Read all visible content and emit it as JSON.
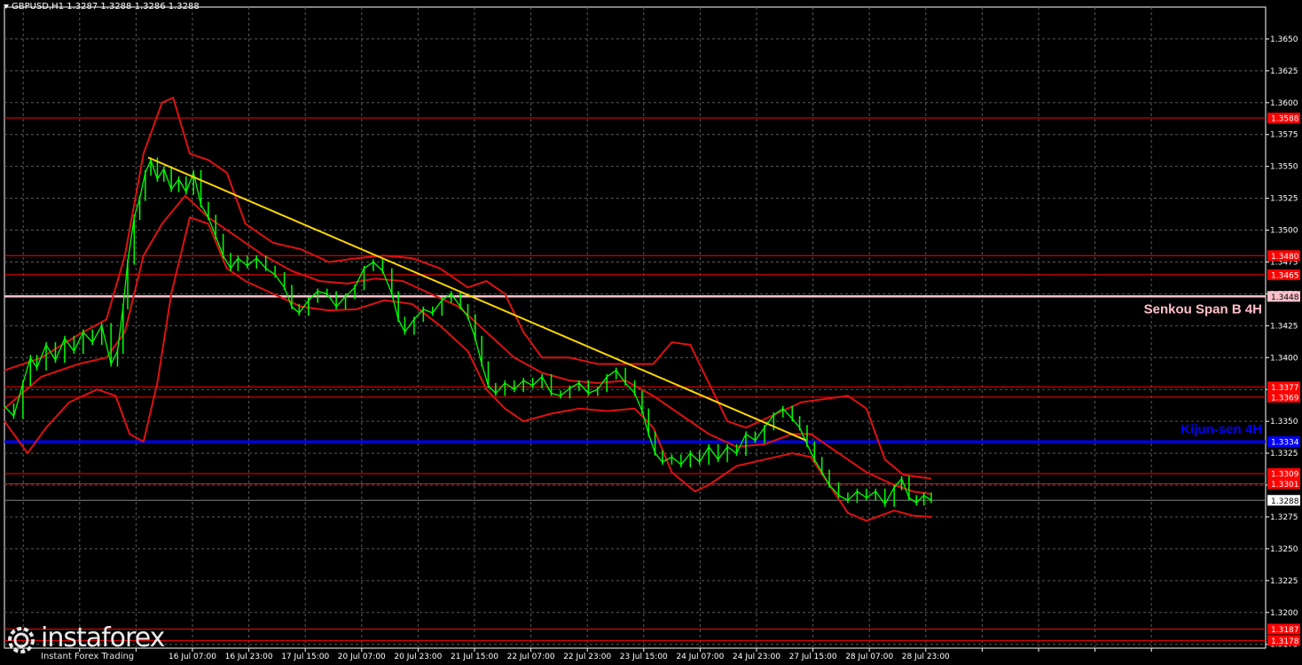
{
  "header": {
    "text": "GBPUSD,H1  1.3287 1.3288 1.3286 1.3288"
  },
  "logo": {
    "name": "instaforex",
    "tagline": "Instant Forex Trading"
  },
  "colors": {
    "background": "#000000",
    "grid": "#5a5a5a",
    "price": "#00ff00",
    "bands": "#dd1111",
    "levels": "#ff0000",
    "trend": "#ffd700",
    "kijun": "#0000ff",
    "senkou": "#ffc0cb",
    "axis": "#ffffff",
    "current": "#7f7f7f"
  },
  "chart_data": {
    "type": "line",
    "symbol": "GBPUSD",
    "timeframe": "H1",
    "ylim": [
      1.3172,
      1.3675
    ],
    "y_ticks": [
      "1.3175",
      "1.3200",
      "1.3225",
      "1.3250",
      "1.3275",
      "1.3300",
      "1.3325",
      "1.3350",
      "1.3375",
      "1.3400",
      "1.3425",
      "1.3450",
      "1.3475",
      "1.3500",
      "1.3525",
      "1.3550",
      "1.3575",
      "1.3600",
      "1.3625",
      "1.3650"
    ],
    "x_ticks": [
      "16 Jul 07:00",
      "16 Jul 23:00",
      "17 Jul 15:00",
      "20 Jul 07:00",
      "20 Jul 23:00",
      "21 Jul 15:00",
      "22 Jul 07:00",
      "22 Jul 23:00",
      "23 Jul 15:00",
      "24 Jul 07:00",
      "24 Jul 23:00",
      "27 Jul 15:00",
      "28 Jul 07:00",
      "28 Jul 23:00"
    ],
    "levels": [
      {
        "label": "1.3588",
        "value": 1.3588
      },
      {
        "label": "1.3480",
        "value": 1.348
      },
      {
        "label": "1.3465",
        "value": 1.3465
      },
      {
        "label": "1.3377",
        "value": 1.3377
      },
      {
        "label": "1.3369",
        "value": 1.3369
      },
      {
        "label": "1.3309",
        "value": 1.3309
      },
      {
        "label": "1.3301",
        "value": 1.3301
      },
      {
        "label": "1.3187",
        "value": 1.3187
      },
      {
        "label": "1.3178",
        "value": 1.3178
      }
    ],
    "senkou_span_b": {
      "label": "Senkou Span B 4H",
      "value": 1.3448,
      "tag": "1.3448"
    },
    "kijun_sen": {
      "label": "Kijun-sen 4H",
      "value": 1.3334,
      "tag": "1.3334"
    },
    "current_price": {
      "label": "1.3288",
      "value": 1.3288
    },
    "trendline": {
      "from": [
        0.155,
        1.3557
      ],
      "to": [
        0.865,
        1.3335
      ]
    },
    "price_series": [
      [
        0.0,
        1.3362
      ],
      [
        0.01,
        1.3354
      ],
      [
        0.02,
        1.338
      ],
      [
        0.028,
        1.34
      ],
      [
        0.035,
        1.3392
      ],
      [
        0.045,
        1.341
      ],
      [
        0.055,
        1.3398
      ],
      [
        0.065,
        1.3415
      ],
      [
        0.075,
        1.3405
      ],
      [
        0.085,
        1.342
      ],
      [
        0.095,
        1.3412
      ],
      [
        0.105,
        1.3425
      ],
      [
        0.115,
        1.3395
      ],
      [
        0.122,
        1.3405
      ],
      [
        0.128,
        1.344
      ],
      [
        0.133,
        1.3475
      ],
      [
        0.14,
        1.351
      ],
      [
        0.146,
        1.3525
      ],
      [
        0.152,
        1.3545
      ],
      [
        0.158,
        1.3555
      ],
      [
        0.165,
        1.354
      ],
      [
        0.172,
        1.3548
      ],
      [
        0.18,
        1.3532
      ],
      [
        0.188,
        1.354
      ],
      [
        0.196,
        1.353
      ],
      [
        0.204,
        1.3545
      ],
      [
        0.212,
        1.352
      ],
      [
        0.22,
        1.351
      ],
      [
        0.228,
        1.3495
      ],
      [
        0.236,
        1.348
      ],
      [
        0.244,
        1.347
      ],
      [
        0.252,
        1.3478
      ],
      [
        0.262,
        1.3472
      ],
      [
        0.272,
        1.3478
      ],
      [
        0.282,
        1.347
      ],
      [
        0.292,
        1.3465
      ],
      [
        0.302,
        1.3455
      ],
      [
        0.31,
        1.344
      ],
      [
        0.318,
        1.3435
      ],
      [
        0.328,
        1.3445
      ],
      [
        0.338,
        1.3452
      ],
      [
        0.348,
        1.345
      ],
      [
        0.358,
        1.344
      ],
      [
        0.368,
        1.3448
      ],
      [
        0.378,
        1.3455
      ],
      [
        0.388,
        1.347
      ],
      [
        0.398,
        1.3475
      ],
      [
        0.408,
        1.3468
      ],
      [
        0.418,
        1.345
      ],
      [
        0.425,
        1.343
      ],
      [
        0.432,
        1.342
      ],
      [
        0.442,
        1.343
      ],
      [
        0.452,
        1.3438
      ],
      [
        0.462,
        1.3435
      ],
      [
        0.472,
        1.3445
      ],
      [
        0.482,
        1.345
      ],
      [
        0.492,
        1.344
      ],
      [
        0.5,
        1.3432
      ],
      [
        0.508,
        1.3415
      ],
      [
        0.515,
        1.3395
      ],
      [
        0.522,
        1.3378
      ],
      [
        0.53,
        1.3372
      ],
      [
        0.54,
        1.338
      ],
      [
        0.55,
        1.3375
      ],
      [
        0.56,
        1.3382
      ],
      [
        0.57,
        1.3378
      ],
      [
        0.58,
        1.3385
      ],
      [
        0.59,
        1.3372
      ],
      [
        0.6,
        1.337
      ],
      [
        0.61,
        1.3376
      ],
      [
        0.62,
        1.338
      ],
      [
        0.63,
        1.3372
      ],
      [
        0.64,
        1.3375
      ],
      [
        0.65,
        1.3385
      ],
      [
        0.66,
        1.339
      ],
      [
        0.67,
        1.338
      ],
      [
        0.68,
        1.3372
      ],
      [
        0.688,
        1.3358
      ],
      [
        0.695,
        1.334
      ],
      [
        0.702,
        1.3325
      ],
      [
        0.71,
        1.3318
      ],
      [
        0.72,
        1.3322
      ],
      [
        0.73,
        1.3316
      ],
      [
        0.74,
        1.3325
      ],
      [
        0.75,
        1.3318
      ],
      [
        0.76,
        1.333
      ],
      [
        0.77,
        1.332
      ],
      [
        0.78,
        1.333
      ],
      [
        0.79,
        1.3325
      ],
      [
        0.8,
        1.334
      ],
      [
        0.81,
        1.3335
      ],
      [
        0.82,
        1.3345
      ],
      [
        0.83,
        1.3355
      ],
      [
        0.84,
        1.336
      ],
      [
        0.85,
        1.3352
      ],
      [
        0.858,
        1.3345
      ],
      [
        0.866,
        1.3332
      ],
      [
        0.874,
        1.332
      ],
      [
        0.882,
        1.331
      ],
      [
        0.89,
        1.33
      ],
      [
        0.9,
        1.3292
      ],
      [
        0.91,
        1.3288
      ],
      [
        0.92,
        1.3295
      ],
      [
        0.93,
        1.329
      ],
      [
        0.94,
        1.3295
      ],
      [
        0.95,
        1.3285
      ],
      [
        0.96,
        1.3298
      ],
      [
        0.968,
        1.3305
      ],
      [
        0.976,
        1.329
      ],
      [
        0.984,
        1.3286
      ],
      [
        0.992,
        1.3292
      ],
      [
        1.0,
        1.3288
      ]
    ],
    "band_upper": [
      [
        0.0,
        1.339
      ],
      [
        0.04,
        1.34
      ],
      [
        0.08,
        1.3418
      ],
      [
        0.11,
        1.343
      ],
      [
        0.13,
        1.348
      ],
      [
        0.15,
        1.356
      ],
      [
        0.17,
        1.36
      ],
      [
        0.182,
        1.3604
      ],
      [
        0.2,
        1.356
      ],
      [
        0.22,
        1.3555
      ],
      [
        0.24,
        1.3545
      ],
      [
        0.26,
        1.3505
      ],
      [
        0.29,
        1.349
      ],
      [
        0.32,
        1.3485
      ],
      [
        0.35,
        1.3475
      ],
      [
        0.38,
        1.3478
      ],
      [
        0.41,
        1.348
      ],
      [
        0.44,
        1.3478
      ],
      [
        0.47,
        1.347
      ],
      [
        0.5,
        1.3455
      ],
      [
        0.52,
        1.346
      ],
      [
        0.54,
        1.345
      ],
      [
        0.56,
        1.342
      ],
      [
        0.58,
        1.34
      ],
      [
        0.61,
        1.34
      ],
      [
        0.64,
        1.3395
      ],
      [
        0.67,
        1.3395
      ],
      [
        0.7,
        1.3395
      ],
      [
        0.72,
        1.3412
      ],
      [
        0.74,
        1.341
      ],
      [
        0.76,
        1.338
      ],
      [
        0.78,
        1.335
      ],
      [
        0.8,
        1.3345
      ],
      [
        0.83,
        1.3355
      ],
      [
        0.86,
        1.3365
      ],
      [
        0.89,
        1.3368
      ],
      [
        0.91,
        1.337
      ],
      [
        0.93,
        1.336
      ],
      [
        0.95,
        1.332
      ],
      [
        0.97,
        1.3308
      ],
      [
        0.99,
        1.3306
      ],
      [
        1.0,
        1.3305
      ]
    ],
    "band_middle": [
      [
        0.0,
        1.336
      ],
      [
        0.04,
        1.3385
      ],
      [
        0.08,
        1.3395
      ],
      [
        0.11,
        1.34
      ],
      [
        0.13,
        1.342
      ],
      [
        0.15,
        1.348
      ],
      [
        0.17,
        1.3505
      ],
      [
        0.195,
        1.3527
      ],
      [
        0.22,
        1.351
      ],
      [
        0.25,
        1.3495
      ],
      [
        0.28,
        1.348
      ],
      [
        0.31,
        1.3468
      ],
      [
        0.34,
        1.346
      ],
      [
        0.37,
        1.3458
      ],
      [
        0.4,
        1.3462
      ],
      [
        0.43,
        1.346
      ],
      [
        0.46,
        1.345
      ],
      [
        0.49,
        1.344
      ],
      [
        0.52,
        1.342
      ],
      [
        0.55,
        1.34
      ],
      [
        0.58,
        1.3388
      ],
      [
        0.61,
        1.3382
      ],
      [
        0.64,
        1.338
      ],
      [
        0.67,
        1.3382
      ],
      [
        0.7,
        1.337
      ],
      [
        0.73,
        1.3355
      ],
      [
        0.76,
        1.334
      ],
      [
        0.79,
        1.333
      ],
      [
        0.82,
        1.3332
      ],
      [
        0.85,
        1.334
      ],
      [
        0.87,
        1.334
      ],
      [
        0.9,
        1.3325
      ],
      [
        0.93,
        1.331
      ],
      [
        0.96,
        1.33
      ],
      [
        0.98,
        1.3295
      ],
      [
        1.0,
        1.3293
      ]
    ],
    "band_lower": [
      [
        0.0,
        1.335
      ],
      [
        0.025,
        1.3325
      ],
      [
        0.045,
        1.3345
      ],
      [
        0.07,
        1.3365
      ],
      [
        0.1,
        1.3375
      ],
      [
        0.12,
        1.337
      ],
      [
        0.135,
        1.334
      ],
      [
        0.15,
        1.3334
      ],
      [
        0.165,
        1.338
      ],
      [
        0.18,
        1.345
      ],
      [
        0.2,
        1.351
      ],
      [
        0.22,
        1.3505
      ],
      [
        0.24,
        1.347
      ],
      [
        0.26,
        1.346
      ],
      [
        0.29,
        1.345
      ],
      [
        0.32,
        1.344
      ],
      [
        0.35,
        1.3437
      ],
      [
        0.38,
        1.3438
      ],
      [
        0.41,
        1.3445
      ],
      [
        0.44,
        1.3442
      ],
      [
        0.47,
        1.3425
      ],
      [
        0.5,
        1.3405
      ],
      [
        0.52,
        1.3375
      ],
      [
        0.54,
        1.336
      ],
      [
        0.56,
        1.335
      ],
      [
        0.59,
        1.3356
      ],
      [
        0.62,
        1.336
      ],
      [
        0.65,
        1.3358
      ],
      [
        0.68,
        1.336
      ],
      [
        0.7,
        1.3345
      ],
      [
        0.72,
        1.331
      ],
      [
        0.745,
        1.3295
      ],
      [
        0.76,
        1.33
      ],
      [
        0.79,
        1.3315
      ],
      [
        0.82,
        1.332
      ],
      [
        0.85,
        1.3325
      ],
      [
        0.87,
        1.3322
      ],
      [
        0.89,
        1.33
      ],
      [
        0.91,
        1.3278
      ],
      [
        0.93,
        1.3272
      ],
      [
        0.96,
        1.328
      ],
      [
        0.98,
        1.3276
      ],
      [
        1.0,
        1.3275
      ]
    ]
  }
}
